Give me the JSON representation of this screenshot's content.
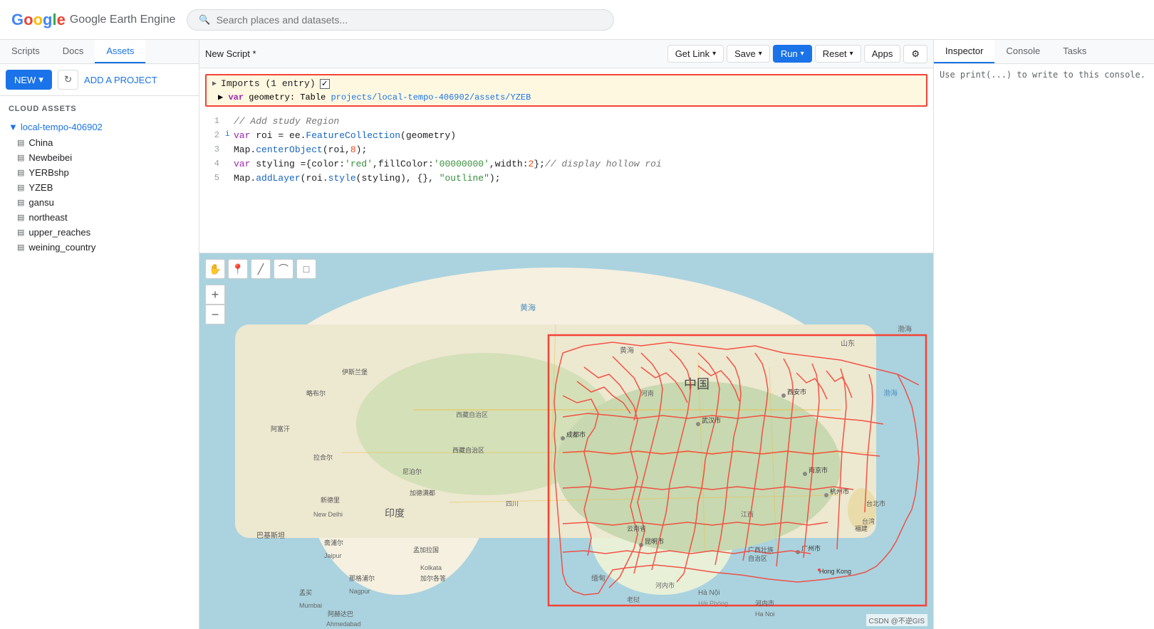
{
  "header": {
    "logo": "Google Earth Engine",
    "search_placeholder": "Search places and datasets..."
  },
  "left_panel": {
    "tabs": [
      "Scripts",
      "Docs",
      "Assets"
    ],
    "active_tab": "Assets",
    "new_label": "NEW",
    "add_project_label": "ADD A PROJECT",
    "cloud_assets_label": "CLOUD ASSETS",
    "project": "local-tempo-406902",
    "tree_items": [
      {
        "name": "China",
        "icon": "▤"
      },
      {
        "name": "Newbeibei",
        "icon": "▤"
      },
      {
        "name": "YERBshp",
        "icon": "▤"
      },
      {
        "name": "YZEB",
        "icon": "▤"
      },
      {
        "name": "gansu",
        "icon": "▤"
      },
      {
        "name": "northeast",
        "icon": "▤"
      },
      {
        "name": "upper_reaches",
        "icon": "▤"
      },
      {
        "name": "weining_country",
        "icon": "▤"
      }
    ]
  },
  "editor": {
    "title": "New Script *",
    "buttons": {
      "get_link": "Get Link",
      "save": "Save",
      "run": "Run",
      "reset": "Reset",
      "apps": "Apps",
      "settings": "⚙"
    },
    "imports": {
      "label": "Imports (1 entry)",
      "var_line": "var geometry: Table",
      "asset_path": "projects/local-tempo-406902/assets/YZEB"
    },
    "code_lines": [
      {
        "num": "1",
        "content": "// Add study Region",
        "type": "comment"
      },
      {
        "num": "2",
        "marker": "i",
        "content": "var roi = ee.FeatureCollection(geometry)"
      },
      {
        "num": "3",
        "content": "Map.centerObject(roi,8);"
      },
      {
        "num": "4",
        "content": "var styling = {color:'red',fillColor:'00000000',width:2};// display hollow roi"
      },
      {
        "num": "5",
        "content": "Map.addLayer(roi.style(styling), {}, \"outline\");"
      }
    ]
  },
  "right_panel": {
    "tabs": [
      "Inspector",
      "Console",
      "Tasks"
    ],
    "active_tab": "Console",
    "console_hint": "Use print(...) to write to this console."
  },
  "map": {
    "attribution": "CSDN @不逆GIS"
  }
}
